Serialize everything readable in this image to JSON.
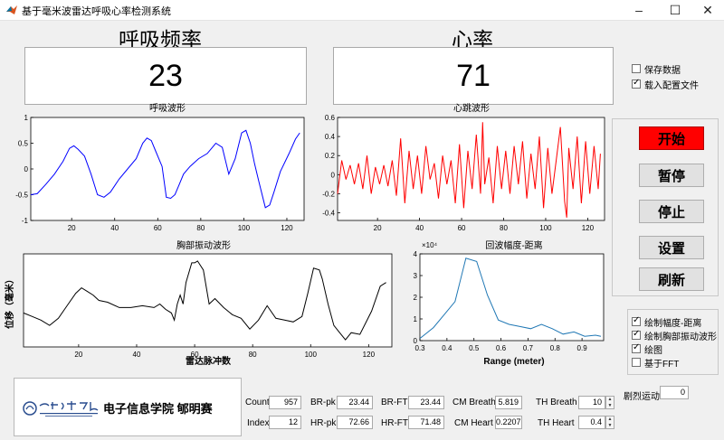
{
  "window": {
    "title": "基于毫米波雷达呼吸心率检测系统"
  },
  "breath": {
    "label": "呼吸频率",
    "value": "23"
  },
  "heart": {
    "label": "心率",
    "value": "71"
  },
  "options_top": [
    {
      "label": "保存数据",
      "checked": false
    },
    {
      "label": "载入配置文件",
      "checked": true
    }
  ],
  "buttons": {
    "start": "开始",
    "pause": "暂停",
    "stop": "停止",
    "settings": "设置",
    "refresh": "刷新"
  },
  "options_bottom": [
    {
      "label": "绘制幅度-距离",
      "checked": true
    },
    {
      "label": "绘制胸部振动波形",
      "checked": true
    },
    {
      "label": "绘图",
      "checked": true
    },
    {
      "label": "基于FFT",
      "checked": false
    }
  ],
  "footer": {
    "school": "电子信息学院 郇明赛",
    "count_label": "Count",
    "count_value": "957",
    "index_label": "Index",
    "index_value": "12",
    "brpk_label": "BR-pk",
    "brpk_value": "23.44",
    "hrpk_label": "HR-pk",
    "hrpk_value": "72.66",
    "brft_label": "BR-FT",
    "brft_value": "23.44",
    "hrft_label": "HR-FT",
    "hrft_value": "71.48",
    "cmbreath_label": "CM Breath",
    "cmbreath_value": "5.819",
    "cmheart_label": "CM  Heart",
    "cmheart_value": "0.2207",
    "thbreath_label": "TH Breath",
    "thbreath_value": "10",
    "thheart_label": "TH  Heart",
    "thheart_value": "0.4",
    "motion_label": "剧烈运动",
    "motion_value": "0"
  },
  "chart_data": [
    {
      "type": "line",
      "title": "呼吸波形",
      "color": "#0000ff",
      "xlim": [
        1,
        128
      ],
      "ylim": [
        -1,
        1
      ],
      "xticks": [
        20,
        40,
        60,
        80,
        100,
        120
      ],
      "yticks": [
        -1,
        -0.5,
        0,
        0.5,
        1
      ],
      "ytick_labels": [
        "-1",
        "-0.5",
        "0",
        "0.5",
        "1"
      ],
      "x": [
        1,
        4,
        8,
        12,
        16,
        19,
        21,
        23,
        26,
        29,
        32,
        35,
        38,
        42,
        46,
        50,
        53,
        55,
        57,
        59,
        62,
        64,
        66,
        68,
        70,
        72,
        75,
        79,
        83,
        87,
        90,
        93,
        96,
        99,
        101,
        103,
        105,
        107,
        110,
        112,
        114,
        117,
        121,
        124,
        126
      ],
      "y": [
        -0.5,
        -0.48,
        -0.3,
        -0.1,
        0.15,
        0.4,
        0.45,
        0.38,
        0.25,
        -0.1,
        -0.5,
        -0.55,
        -0.45,
        -0.2,
        0,
        0.2,
        0.5,
        0.6,
        0.55,
        0.35,
        0.05,
        -0.55,
        -0.57,
        -0.5,
        -0.3,
        -0.1,
        0.05,
        0.2,
        0.3,
        0.5,
        0.42,
        -0.1,
        0.2,
        0.7,
        0.75,
        0.5,
        0.1,
        -0.25,
        -0.75,
        -0.7,
        -0.45,
        -0.05,
        0.3,
        0.58,
        0.7
      ]
    },
    {
      "type": "line",
      "title": "心跳波形",
      "color": "#ff0000",
      "xlim": [
        1,
        128
      ],
      "ylim": [
        -0.45,
        0.6
      ],
      "xticks": [
        20,
        40,
        60,
        80,
        100,
        120
      ],
      "yticks": [
        -0.4,
        -0.2,
        0,
        0.2,
        0.4,
        0.6
      ],
      "ytick_labels": [
        "-0.4",
        "-0.2",
        "0",
        "0.2",
        "0.4",
        "0.6"
      ],
      "x": [
        1,
        3,
        5,
        7,
        9,
        11,
        13,
        15,
        17,
        19,
        21,
        23,
        25,
        27,
        29,
        31,
        33,
        35,
        37,
        39,
        41,
        43,
        45,
        47,
        49,
        51,
        53,
        55,
        57,
        59,
        61,
        63,
        65,
        67,
        69,
        70,
        71,
        73,
        75,
        77,
        79,
        81,
        83,
        85,
        87,
        89,
        91,
        93,
        95,
        97,
        99,
        101,
        103,
        105,
        107,
        109,
        110,
        111,
        113,
        115,
        117,
        119,
        121,
        123,
        125,
        126
      ],
      "y": [
        -0.2,
        0.15,
        -0.05,
        0.1,
        -0.1,
        0.12,
        -0.15,
        0.2,
        -0.2,
        0.08,
        -0.1,
        0.1,
        -0.12,
        0.15,
        -0.22,
        0.38,
        -0.3,
        0.25,
        -0.15,
        0.2,
        -0.2,
        0.3,
        -0.05,
        0.12,
        -0.25,
        0.2,
        -0.1,
        0.15,
        -0.3,
        0.32,
        -0.35,
        0.25,
        -0.15,
        0.42,
        -0.2,
        0.55,
        -0.1,
        0.18,
        -0.3,
        0.3,
        -0.15,
        0.25,
        -0.2,
        0.3,
        -0.1,
        0.35,
        -0.25,
        0.22,
        -0.15,
        0.4,
        -0.35,
        0.28,
        -0.2,
        0.15,
        0.5,
        -0.28,
        -0.45,
        0.28,
        -0.15,
        0.4,
        -0.3,
        0.35,
        -0.2,
        0.3,
        -0.15,
        0.22
      ]
    },
    {
      "type": "line",
      "title": "胸部振动波形",
      "color": "#000000",
      "xlabel": "雷达脉冲数",
      "ylabel": "位移（毫米）",
      "xlim": [
        1,
        128
      ],
      "xticks": [
        20,
        40,
        60,
        80,
        100,
        120
      ],
      "x": [
        1,
        4,
        7,
        10,
        13,
        16,
        19,
        21,
        23,
        25,
        27,
        30,
        34,
        38,
        42,
        46,
        48,
        50,
        52,
        53,
        54,
        55,
        56,
        57,
        59,
        60,
        61,
        63,
        65,
        67,
        70,
        73,
        76,
        79,
        82,
        85,
        88,
        91,
        94,
        97,
        99,
        101,
        103,
        104,
        106,
        108,
        110,
        112,
        114,
        117,
        121,
        124,
        126
      ],
      "y": [
        0.35,
        0.25,
        0.15,
        0,
        0.2,
        0.55,
        0.9,
        1.05,
        0.95,
        0.85,
        0.7,
        0.65,
        0.5,
        0.5,
        0.55,
        0.5,
        0.6,
        0.45,
        0.35,
        0.15,
        0.6,
        0.85,
        0.6,
        1.2,
        1.75,
        1.75,
        1.8,
        1.55,
        0.6,
        0.75,
        0.5,
        0.3,
        0.2,
        -0.1,
        0.15,
        0.55,
        0.2,
        0.15,
        0.1,
        0.25,
        0.9,
        1.6,
        1.55,
        1.3,
        0.6,
        0,
        -0.2,
        -0.4,
        -0.2,
        -0.25,
        0.4,
        1.1,
        1.2
      ]
    },
    {
      "type": "line",
      "title": "回波幅度-距离",
      "color": "#1f77b4",
      "xlabel": "Range (meter)",
      "exponent_label": "×10⁴",
      "xlim": [
        0.3,
        0.98
      ],
      "ylim": [
        0,
        4
      ],
      "xticks": [
        0.3,
        0.4,
        0.5,
        0.6,
        0.7,
        0.8,
        0.9
      ],
      "yticks": [
        0,
        1,
        2,
        3,
        4
      ],
      "xtick_labels": [
        "0.3",
        "0.4",
        "0.5",
        "0.6",
        "0.7",
        "0.8",
        "0.9"
      ],
      "ytick_labels": [
        "0",
        "1",
        "2",
        "3",
        "4"
      ],
      "x": [
        0.3,
        0.35,
        0.39,
        0.43,
        0.47,
        0.51,
        0.55,
        0.59,
        0.63,
        0.67,
        0.71,
        0.75,
        0.79,
        0.83,
        0.87,
        0.91,
        0.95,
        0.97
      ],
      "y": [
        0.1,
        0.6,
        1.2,
        1.8,
        3.8,
        3.65,
        2.1,
        0.95,
        0.75,
        0.65,
        0.55,
        0.75,
        0.55,
        0.3,
        0.4,
        0.2,
        0.25,
        0.2
      ]
    }
  ]
}
